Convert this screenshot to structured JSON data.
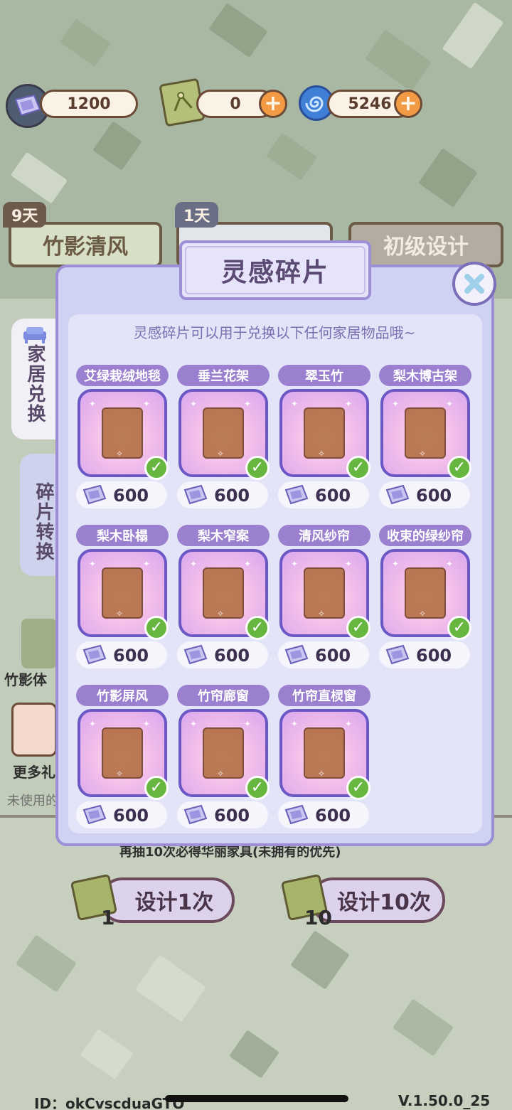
{
  "currencies": [
    {
      "icon": "fragment-icon",
      "value": "1200",
      "has_plus": false
    },
    {
      "icon": "bamboo-ticket-icon",
      "value": "0",
      "has_plus": true
    },
    {
      "icon": "spiral-gem-icon",
      "value": "5246",
      "has_plus": true
    }
  ],
  "banner_tabs": {
    "tab1": {
      "label": "竹影清风",
      "days": "9天"
    },
    "tab2": {
      "days": "1天"
    },
    "tab3": {
      "label": "初级设计"
    }
  },
  "side_tabs": {
    "home_exchange": "家居兑换",
    "fragment_convert": "碎片转换"
  },
  "background": {
    "left_partial_1": "竹影体",
    "left_partial_2": "更多礼",
    "left_partial_3": "未使用的",
    "guarantee_text": "再抽10次必得华丽家具(未拥有的优先)"
  },
  "modal": {
    "title": "灵感碎片",
    "description": "灵感碎片可以用于兑换以下任何家居物品哦~",
    "items": [
      {
        "name": "艾绿栽绒地毯",
        "price": "600",
        "owned": true
      },
      {
        "name": "垂兰花架",
        "price": "600",
        "owned": true
      },
      {
        "name": "翠玉竹",
        "price": "600",
        "owned": true
      },
      {
        "name": "梨木博古架",
        "price": "600",
        "owned": true
      },
      {
        "name": "梨木卧榻",
        "price": "600",
        "owned": true
      },
      {
        "name": "梨木窄案",
        "price": "600",
        "owned": true
      },
      {
        "name": "清风纱帘",
        "price": "600",
        "owned": true
      },
      {
        "name": "收束的绿纱帘",
        "price": "600",
        "owned": true
      },
      {
        "name": "竹影屏风",
        "price": "600",
        "owned": true
      },
      {
        "name": "竹帘廊窗",
        "price": "600",
        "owned": true
      },
      {
        "name": "竹帘直棂窗",
        "price": "600",
        "owned": true
      }
    ]
  },
  "actions": {
    "design_once": {
      "label": "设计1次",
      "count": "1"
    },
    "design_ten": {
      "label": "设计10次",
      "count": "10"
    }
  },
  "footer": {
    "id_text": "ID：okCvscduaGTO",
    "version": "V.1.50.0_25"
  }
}
